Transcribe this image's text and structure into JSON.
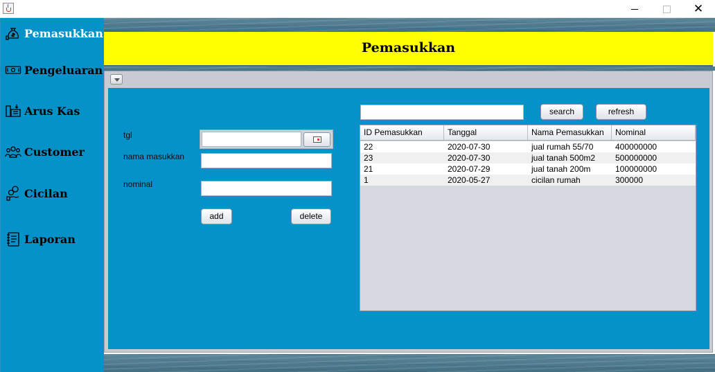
{
  "window": {
    "close_glyph": "✕"
  },
  "sidebar": {
    "items": [
      {
        "label": "Pemasukkan",
        "icon": "money-bag-icon",
        "active": true
      },
      {
        "label": "Pengeluaran",
        "icon": "banknote-icon",
        "active": false
      },
      {
        "label": "Arus Kas",
        "icon": "cash-flow-icon",
        "active": false
      },
      {
        "label": "Customer",
        "icon": "users-icon",
        "active": false
      },
      {
        "label": "Cicilan",
        "icon": "installment-icon",
        "active": false
      },
      {
        "label": "Laporan",
        "icon": "report-icon",
        "active": false
      }
    ]
  },
  "header": {
    "title": "Pemasukkan"
  },
  "form": {
    "tgl_label": "tgl",
    "nama_label": "nama masukkan",
    "nominal_label": "nominal",
    "tgl_value": "",
    "nama_value": "",
    "nominal_value": "",
    "add_label": "add",
    "delete_label": "delete"
  },
  "search": {
    "value": "",
    "search_label": "search",
    "refresh_label": "refresh"
  },
  "table": {
    "columns": [
      "ID Pemasukkan",
      "Tanggal",
      "Nama Pemasukkan",
      "Nominal"
    ],
    "rows": [
      [
        "22",
        "2020-07-30",
        "jual rumah 55/70",
        "400000000"
      ],
      [
        "23",
        "2020-07-30",
        "jual tanah 500m2",
        "500000000"
      ],
      [
        "21",
        "2020-07-29",
        "jual tanah 200m",
        "100000000"
      ],
      [
        "1",
        "2020-05-27",
        "cicilan rumah",
        "300000"
      ]
    ]
  },
  "colors": {
    "sidebar_bg": "#0592c9",
    "header_bg": "#ffff00",
    "content_bg": "#0592c9",
    "table_bg": "#d5d8de",
    "active_text": "#ffffff"
  }
}
